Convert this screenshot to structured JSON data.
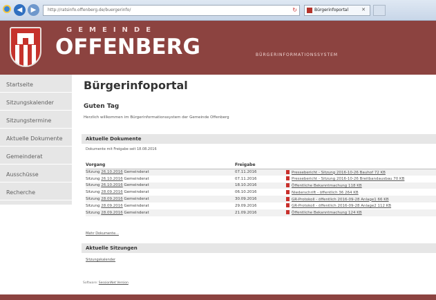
{
  "browser": {
    "address": "http://ratsinfo.offenberg.de/buergerinfo/",
    "tab_title": "Bürgerinfoportal"
  },
  "header": {
    "brand_sub": "GEMEINDE",
    "brand_main": "OFFENBERG",
    "tagline": "BÜRGERINFORMATIONSSYSTEM",
    "color": "#8c4340"
  },
  "sidebar": {
    "items": [
      {
        "label": "Startseite"
      },
      {
        "label": "Sitzungskalender"
      },
      {
        "label": "Sitzungstermine"
      },
      {
        "label": "Aktuelle Dokumente"
      },
      {
        "label": "Gemeinderat"
      },
      {
        "label": "Ausschüsse"
      },
      {
        "label": "Recherche"
      }
    ]
  },
  "main": {
    "title": "Bürgerinfoportal",
    "greeting": "Guten Tag",
    "welcome": "Herzlich willkommen im Bürgerinformationssystem der Gemeinde Offenberg",
    "docs_section": "Aktuelle Dokumente",
    "docs_note": "Dokumente mit Freigabe seit 18.08.2016",
    "columns": {
      "vorgang": "Vorgang",
      "freigabe": "Freigabe",
      "dokument": ""
    },
    "rows": [
      {
        "sitzung": "Sitzung",
        "date": "26.10.2016",
        "gremium": "Gemeinderat",
        "freigabe": "07.11.2016",
        "doc": "Pressebericht - Sitzung 2016-10-26 Bauhof 72 KB"
      },
      {
        "sitzung": "Sitzung",
        "date": "26.10.2016",
        "gremium": "Gemeinderat",
        "freigabe": "07.11.2016",
        "doc": "Pressebericht - Sitzung 2016-10-26 Breitbandausbau 70 KB"
      },
      {
        "sitzung": "Sitzung",
        "date": "26.10.2016",
        "gremium": "Gemeinderat",
        "freigabe": "18.10.2016",
        "doc": "Öffentliche Bekanntmachung 118 KB"
      },
      {
        "sitzung": "Sitzung",
        "date": "28.09.2016",
        "gremium": "Gemeinderat",
        "freigabe": "06.10.2016",
        "doc": "Niederschrift - öffentlich 36 264 KB"
      },
      {
        "sitzung": "Sitzung",
        "date": "28.09.2016",
        "gremium": "Gemeinderat",
        "freigabe": "30.09.2016",
        "doc": "GR-Protokoll - öffentlich 2016-09-28 Anlage1 66 KB"
      },
      {
        "sitzung": "Sitzung",
        "date": "28.09.2016",
        "gremium": "Gemeinderat",
        "freigabe": "29.09.2016",
        "doc": "GR-Protokoll - öffentlich 2016-09-28 Anlage2 112 KB"
      },
      {
        "sitzung": "Sitzung",
        "date": "28.09.2016",
        "gremium": "Gemeinderat",
        "freigabe": "21.09.2016",
        "doc": "Öffentliche Bekanntmachung 124 KB"
      }
    ],
    "more_docs": "Mehr Dokumente...",
    "sitz_section": "Aktuelle Sitzungen",
    "sitz_link": "Sitzungskalender",
    "software_label": "Software:",
    "software_link": "SessionNet Version"
  }
}
